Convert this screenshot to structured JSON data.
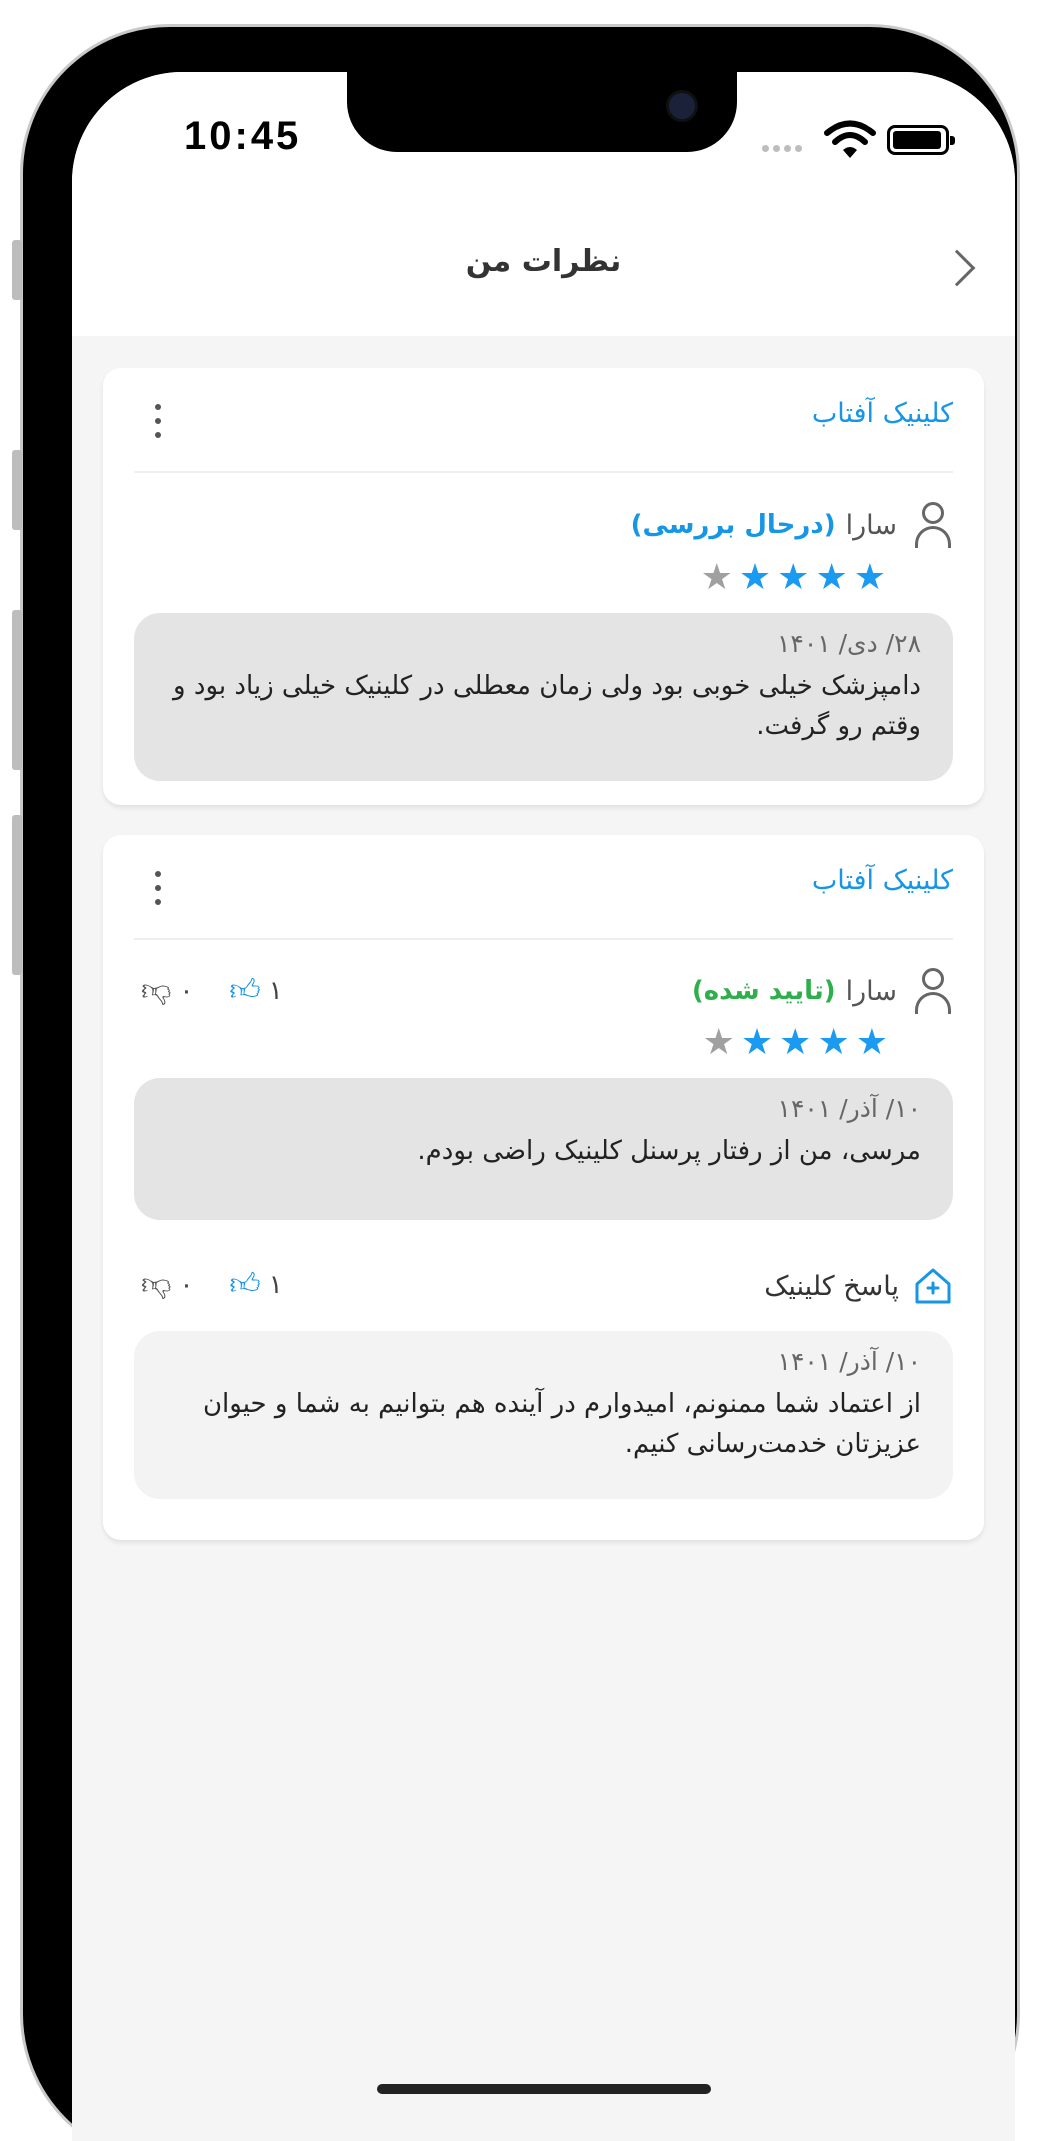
{
  "status_bar": {
    "time": "10:45"
  },
  "header": {
    "title": "نظرات من"
  },
  "reviews": [
    {
      "clinic": "کلینیک آفتاب",
      "user": "سارا",
      "status": "(درحال بررسی)",
      "rating": 4,
      "date": "۲۸/ دی/ ۱۴۰۱",
      "text": "دامپزشک خیلی خوبی بود ولی زمان معطلی در کلینیک خیلی زیاد بود و وقتم رو گرفت."
    },
    {
      "clinic": "کلینیک آفتاب",
      "user": "سارا",
      "status": "(تایید شده)",
      "rating": 4,
      "likes": "۱",
      "dislikes": "۰",
      "date": "۱۰/ آذر/ ۱۴۰۱",
      "text": "مرسی، من از رفتار پرسنل کلینیک راضی بودم.",
      "reply": {
        "label": "پاسخ کلینیک",
        "likes": "۱",
        "dislikes": "۰",
        "date": "۱۰/ آذر/ ۱۴۰۱",
        "text": "از اعتماد شما ممنونم، امیدوارم در آینده هم بتوانیم به شما و حیوان عزیزتان خدمت‌رسانی کنیم."
      }
    }
  ],
  "colors": {
    "accent": "#1796e6",
    "approved": "#2fae4c",
    "star_on": "#1a9af0",
    "star_off": "#a0a0a0"
  }
}
